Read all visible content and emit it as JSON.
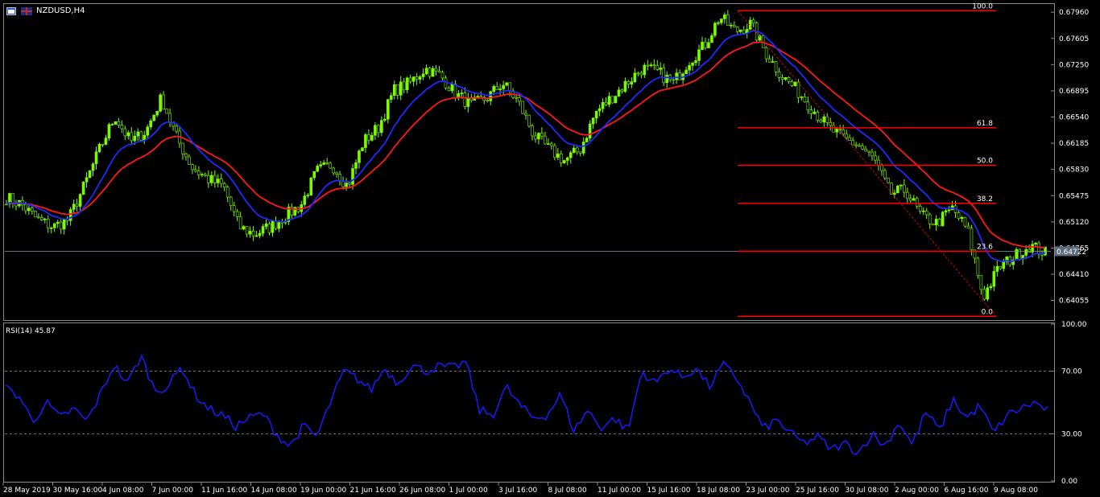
{
  "header": {
    "symbol_label": "NZDUSD,H4",
    "price_badge": "0.64722"
  },
  "colors": {
    "background": "#000000",
    "bull": "#7CFC00",
    "bear": "#3a3a3a",
    "ma_fast": "#1e2bff",
    "ma_slow": "#ff1a1a",
    "fib": "#ff0000",
    "rsi": "#1a1aff",
    "axis_text": "#ffffff",
    "price_line": "#8899aa"
  },
  "chart_data": [
    {
      "type": "candlestick",
      "title": "NZDUSD,H4",
      "ylim": [
        0.638,
        0.6806
      ],
      "y_ticks": [
        "0.67960",
        "0.67605",
        "0.67250",
        "0.66895",
        "0.66540",
        "0.66185",
        "0.65830",
        "0.65475",
        "0.65120",
        "0.64765",
        "0.64410",
        "0.64055"
      ],
      "x_ticks": [
        "28 May 2019",
        "30 May 16:00",
        "4 Jun 08:00",
        "7 Jun 00:00",
        "11 Jun 16:00",
        "14 Jun 08:00",
        "19 Jun 00:00",
        "21 Jun 16:00",
        "26 Jun 08:00",
        "1 Jul 00:00",
        "3 Jul 16:00",
        "8 Jul 08:00",
        "11 Jul 00:00",
        "15 Jul 16:00",
        "18 Jul 08:00",
        "23 Jul 00:00",
        "25 Jul 16:00",
        "30 Jul 08:00",
        "2 Aug 00:00",
        "6 Aug 16:00",
        "9 Aug 08:00"
      ],
      "price_anchors": [
        0.6545,
        0.6535,
        0.6515,
        0.6505,
        0.6515,
        0.656,
        0.661,
        0.6655,
        0.662,
        0.6635,
        0.668,
        0.6625,
        0.6585,
        0.657,
        0.656,
        0.6505,
        0.6495,
        0.6505,
        0.652,
        0.6535,
        0.658,
        0.659,
        0.656,
        0.662,
        0.664,
        0.669,
        0.67,
        0.672,
        0.671,
        0.6685,
        0.667,
        0.668,
        0.67,
        0.6675,
        0.663,
        0.661,
        0.6595,
        0.661,
        0.666,
        0.668,
        0.67,
        0.672,
        0.6715,
        0.67,
        0.673,
        0.675,
        0.679,
        0.677,
        0.678,
        0.674,
        0.671,
        0.669,
        0.6665,
        0.664,
        0.6625,
        0.6615,
        0.6595,
        0.655,
        0.6555,
        0.652,
        0.651,
        0.653,
        0.65,
        0.641,
        0.645,
        0.6465,
        0.648,
        0.647
      ],
      "ma_fast_label": "",
      "ma_slow_label": "",
      "current_price": 0.64722,
      "fibonacci": {
        "high": 0.6798,
        "low": 0.6384,
        "levels": [
          {
            "label": "100.0",
            "value": 0.6798
          },
          {
            "label": "61.8",
            "value": 0.66395
          },
          {
            "label": "50.0",
            "value": 0.65885
          },
          {
            "label": "38.2",
            "value": 0.6537
          },
          {
            "label": "23.6",
            "value": 0.64722
          },
          {
            "label": "0.0",
            "value": 0.6384
          }
        ]
      }
    },
    {
      "type": "line",
      "title": "RSI(14) 45.87",
      "ylim": [
        0,
        100
      ],
      "y_ticks": [
        "100.00",
        "70.00",
        "30.00",
        "0.00"
      ],
      "levels": [
        70,
        30
      ],
      "rsi_anchors": [
        59,
        54,
        38,
        50,
        40,
        46,
        38,
        55,
        74,
        62,
        80,
        58,
        60,
        73,
        55,
        46,
        42,
        35,
        40,
        43,
        30,
        22,
        35,
        28,
        50,
        70,
        65,
        58,
        72,
        62,
        74,
        70,
        73,
        72,
        76,
        45,
        42,
        60,
        48,
        40,
        42,
        55,
        32,
        45,
        34,
        40,
        32,
        70,
        62,
        72,
        66,
        72,
        60,
        74,
        66,
        50,
        33,
        39,
        30,
        24,
        28,
        20,
        24,
        18,
        30,
        22,
        38,
        23,
        44,
        32,
        52,
        40,
        48,
        30,
        42,
        46,
        50,
        45
      ]
    }
  ]
}
